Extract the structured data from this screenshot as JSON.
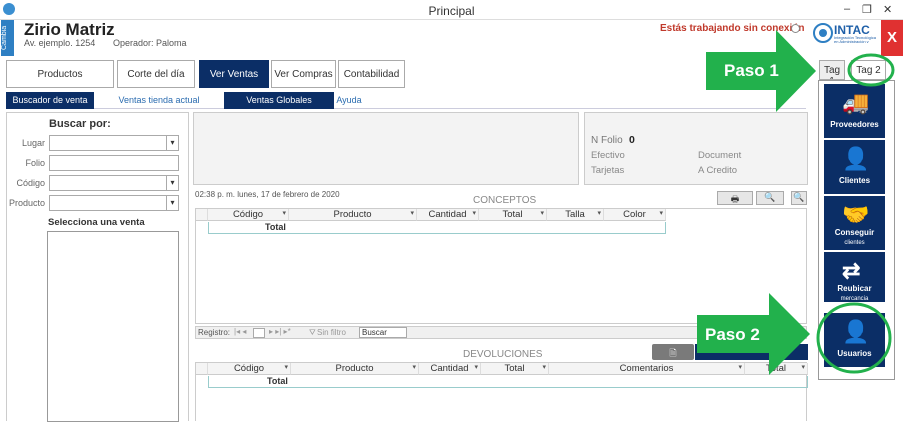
{
  "window": {
    "title": "Principal",
    "minimize": "–",
    "restore": "❐",
    "close": "✕"
  },
  "header": {
    "side_label": "Cambia",
    "company": "Zirio Matriz",
    "address": "Av. ejemplo. 1254",
    "operator": "Operador: Paloma",
    "offline_text": "Estás trabajando sin conexión",
    "logo_text": "INTAC",
    "logo_subtext": "Integración Tecnológica en Administración y Control",
    "close_label": "X"
  },
  "tabs": [
    "Productos",
    "Corte del día",
    "Ver Ventas",
    "Ver Compras",
    "Contabilidad"
  ],
  "right_tabs": [
    "Tag 1",
    "Tag 2"
  ],
  "subnav": [
    "Buscador de venta",
    "Ventas tienda actual",
    "Ventas Globales",
    "Ayuda"
  ],
  "search": {
    "title": "Buscar por:",
    "fields": [
      "Lugar",
      "Folio",
      "Código",
      "Producto"
    ],
    "select_label": "Selecciona una venta"
  },
  "info": {
    "folio_label": "N Folio",
    "folio_value": "0",
    "efectivo": "Efectivo",
    "document": "Document",
    "tarjetas": "Tarjetas",
    "credito": "A Credito"
  },
  "timestamp": "02:38 p. m. lunes, 17 de febrero de 2020",
  "conceptos": {
    "title": "CONCEPTOS",
    "columns": [
      "Código",
      "Producto",
      "Cantidad",
      "Total",
      "Talla",
      "Color"
    ],
    "total_label": "Total"
  },
  "pager": {
    "registro": "Registro:",
    "sin_filtro": "Sin filtro",
    "buscar": "Buscar"
  },
  "devoluciones": {
    "title": "DEVOLUCIONES",
    "columns": [
      "Código",
      "Producto",
      "Cantidad",
      "Total",
      "Comentarios",
      "Total"
    ],
    "total_label": "Total"
  },
  "sidebar": [
    {
      "label": "Proveedores",
      "icon": "truck-icon",
      "glyph": "🚚"
    },
    {
      "label": "Clientes",
      "icon": "clients-icon",
      "glyph": "👤"
    },
    {
      "label": "Conseguir",
      "sub": "clientes",
      "icon": "handshake-icon",
      "glyph": "🤝"
    },
    {
      "label": "Reubicar",
      "sub": "mercancia",
      "icon": "shuffle-icon",
      "glyph": "⇄"
    },
    {
      "label": "Usuarios",
      "icon": "user-icon",
      "glyph": "👤"
    }
  ],
  "annotations": [
    "Paso 1",
    "Paso 2"
  ],
  "colors": {
    "navy": "#0b2e66",
    "green": "#22b14c",
    "red": "#e03131",
    "accent_blue": "#2b6cb0"
  }
}
